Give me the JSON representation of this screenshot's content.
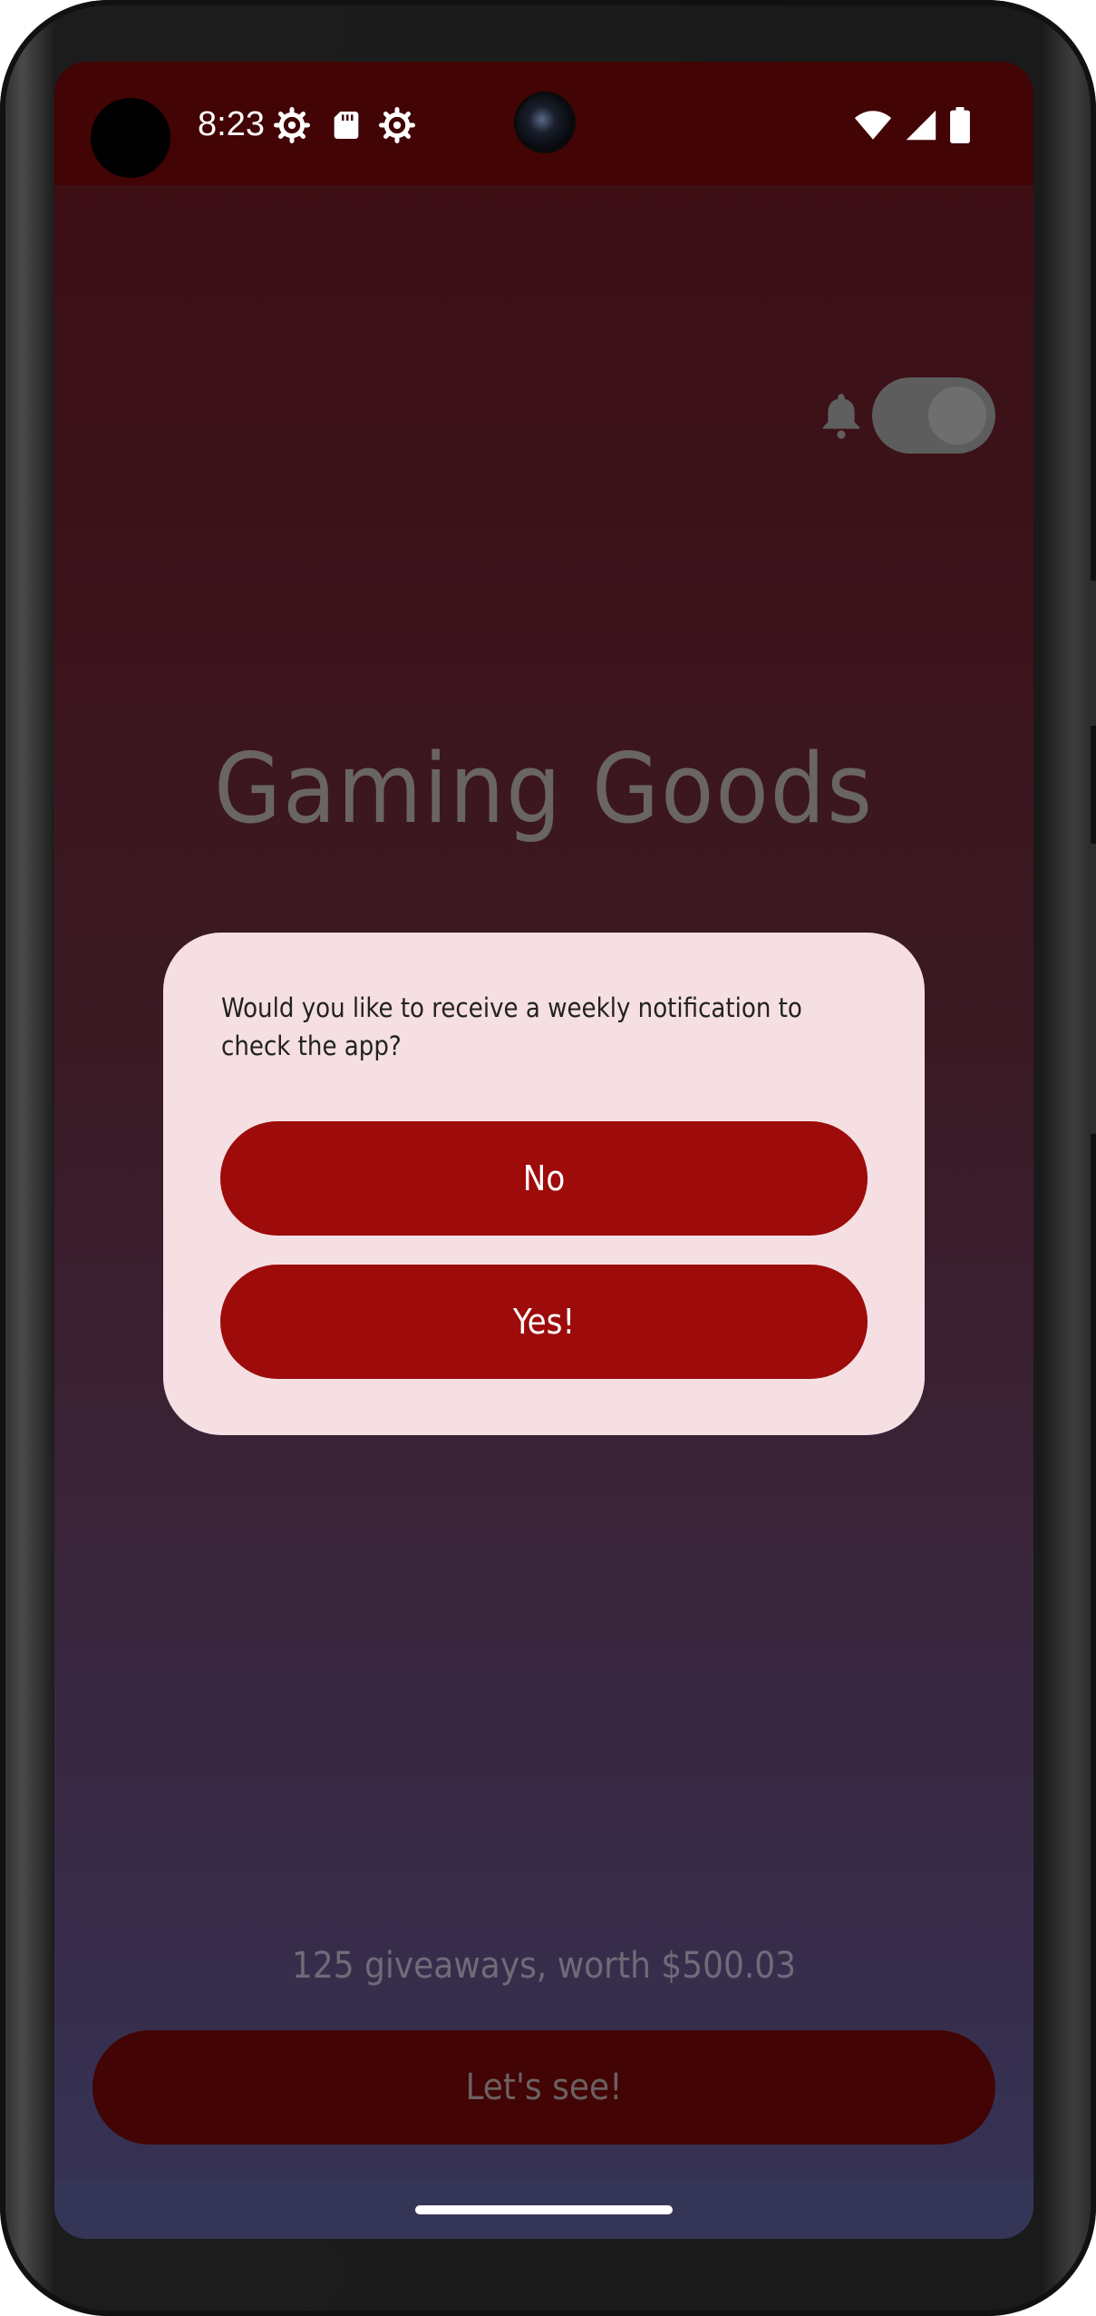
{
  "status_bar": {
    "time": "8:23",
    "left_icons": [
      "settings-gear-icon",
      "sd-card-icon",
      "settings-gear-icon"
    ],
    "right_icons": [
      "wifi-icon",
      "cell-signal-icon",
      "battery-icon"
    ]
  },
  "notifications_toggle": {
    "state": "off"
  },
  "app": {
    "title": "Gaming Goods",
    "giveaways_summary": "125 giveaways, worth $500.03",
    "cta_label": "Let's see!"
  },
  "dialog": {
    "message": "Would you like to receive a weekly notification to check the app?",
    "no_label": "No",
    "yes_label": "Yes!"
  },
  "colors": {
    "status_bar_bg": "#420404",
    "button_primary": "#9d0b0b",
    "dialog_bg": "#f5dfe2",
    "cta_bg": "#420404"
  }
}
